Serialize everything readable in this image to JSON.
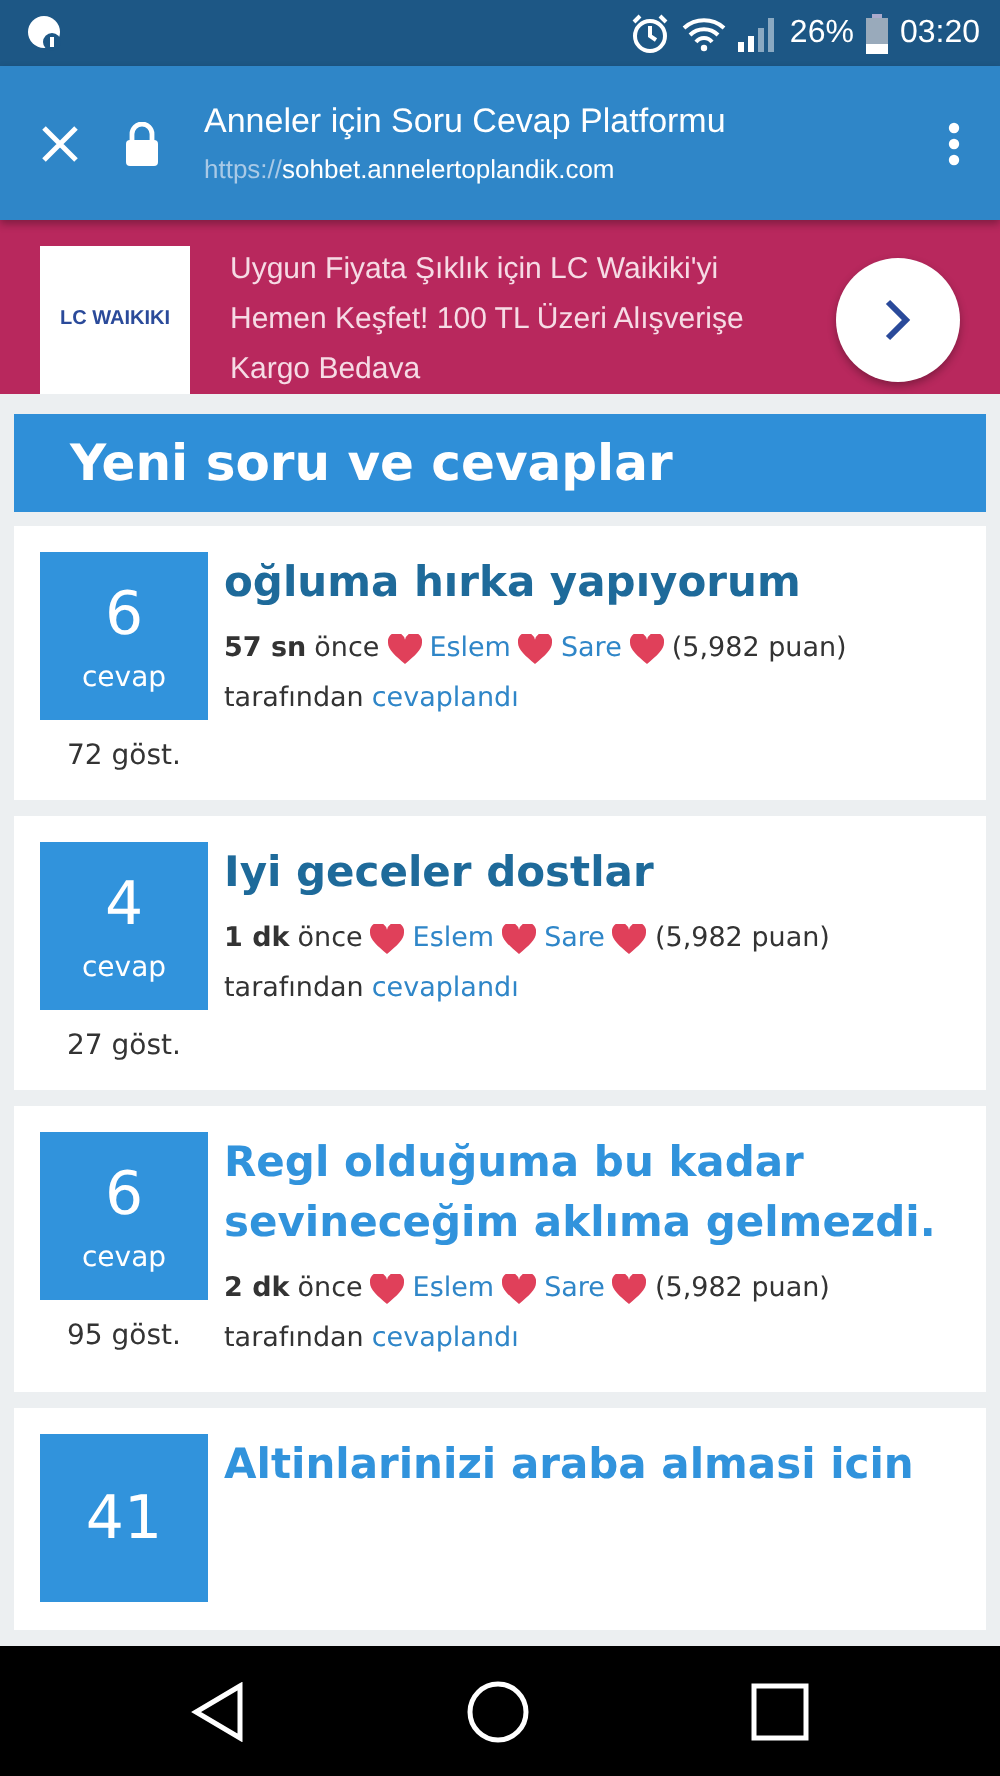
{
  "status_bar": {
    "battery": "26%",
    "time": "03:20"
  },
  "browser_bar": {
    "title": "Anneler için Soru Cevap Platformu",
    "url_scheme": "https://",
    "url_host": "sohbet.annelertoplandik.com"
  },
  "ad": {
    "logo": "LC WAIKIKI",
    "text": "Uygun Fiyata Şıklık için LC Waikiki'yi Hemen Keşfet! 100 TL Üzeri Alışverişe Kargo Bedava"
  },
  "section": {
    "title": "Yeni soru ve cevaplar"
  },
  "questions": [
    {
      "count": "6",
      "count_label": "cevap",
      "views": "72 göst.",
      "title": "oğluma hırka yapıyorum",
      "visited": true,
      "age": "57 sn",
      "age_suffix": "önce",
      "user": "Eslem",
      "user2": "Sare",
      "points": "(5,982 puan)",
      "by": "tarafından",
      "action": "cevaplandı"
    },
    {
      "count": "4",
      "count_label": "cevap",
      "views": "27 göst.",
      "title": "Iyi geceler dostlar",
      "visited": true,
      "age": "1 dk",
      "age_suffix": "önce",
      "user": "Eslem",
      "user2": "Sare",
      "points": "(5,982 puan)",
      "by": "tarafından",
      "action": "cevaplandı"
    },
    {
      "count": "6",
      "count_label": "cevap",
      "views": "95 göst.",
      "title": "Regl olduğuma bu kadar sevineceğim aklıma gelmezdi.",
      "visited": false,
      "age": "2 dk",
      "age_suffix": "önce",
      "user": "Eslem",
      "user2": "Sare",
      "points": "(5,982 puan)",
      "by": "tarafından",
      "action": "cevaplandı"
    },
    {
      "count": "41",
      "title": "Altinlarinizi araba almasi icin",
      "visited": false
    }
  ]
}
